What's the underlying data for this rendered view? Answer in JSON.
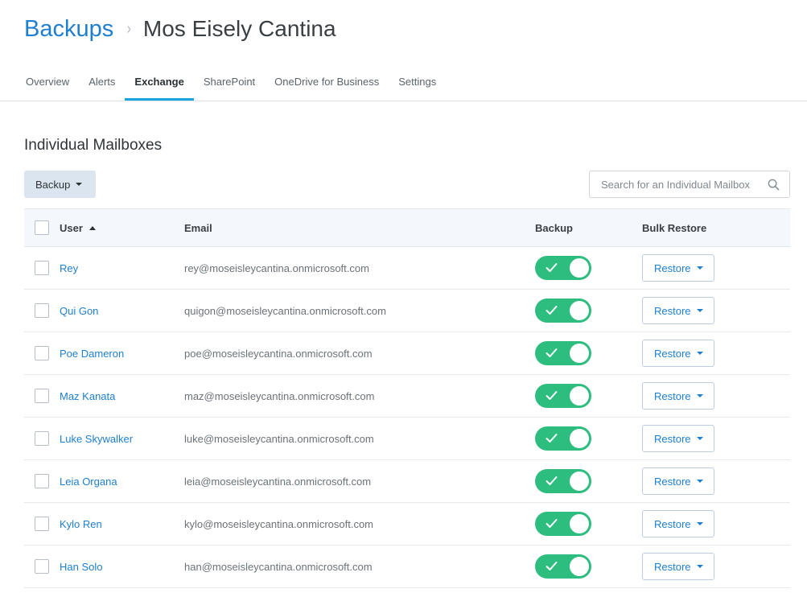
{
  "breadcrumb": {
    "root": "Backups",
    "separator": "›",
    "current": "Mos Eisely Cantina"
  },
  "tabs": [
    {
      "label": "Overview",
      "active": false
    },
    {
      "label": "Alerts",
      "active": false
    },
    {
      "label": "Exchange",
      "active": true
    },
    {
      "label": "SharePoint",
      "active": false
    },
    {
      "label": "OneDrive for Business",
      "active": false
    },
    {
      "label": "Settings",
      "active": false
    }
  ],
  "section_title": "Individual Mailboxes",
  "toolbar": {
    "backup_label": "Backup",
    "search_placeholder": "Search for an Individual Mailbox"
  },
  "table": {
    "headers": {
      "user": "User",
      "email": "Email",
      "backup": "Backup",
      "bulk_restore": "Bulk Restore"
    },
    "sort": {
      "column": "user",
      "direction": "ascending"
    },
    "restore_label": "Restore",
    "rows": [
      {
        "user": "Rey",
        "email": "rey@moseisleycantina.onmicrosoft.com",
        "backup_enabled": true
      },
      {
        "user": "Qui Gon",
        "email": "quigon@moseisleycantina.onmicrosoft.com",
        "backup_enabled": true
      },
      {
        "user": "Poe Dameron",
        "email": "poe@moseisleycantina.onmicrosoft.com",
        "backup_enabled": true
      },
      {
        "user": "Maz Kanata",
        "email": "maz@moseisleycantina.onmicrosoft.com",
        "backup_enabled": true
      },
      {
        "user": "Luke Skywalker",
        "email": "luke@moseisleycantina.onmicrosoft.com",
        "backup_enabled": true
      },
      {
        "user": "Leia Organa",
        "email": "leia@moseisleycantina.onmicrosoft.com",
        "backup_enabled": true
      },
      {
        "user": "Kylo Ren",
        "email": "kylo@moseisleycantina.onmicrosoft.com",
        "backup_enabled": true
      },
      {
        "user": "Han Solo",
        "email": "han@moseisleycantina.onmicrosoft.com",
        "backup_enabled": true
      }
    ]
  },
  "colors": {
    "link": "#1e7fd0",
    "tab_active_underline": "#1aa5df",
    "toggle_on": "#2dbd7e",
    "header_bg": "#f4f7fb",
    "backup_button_bg": "#dbe5ef"
  }
}
